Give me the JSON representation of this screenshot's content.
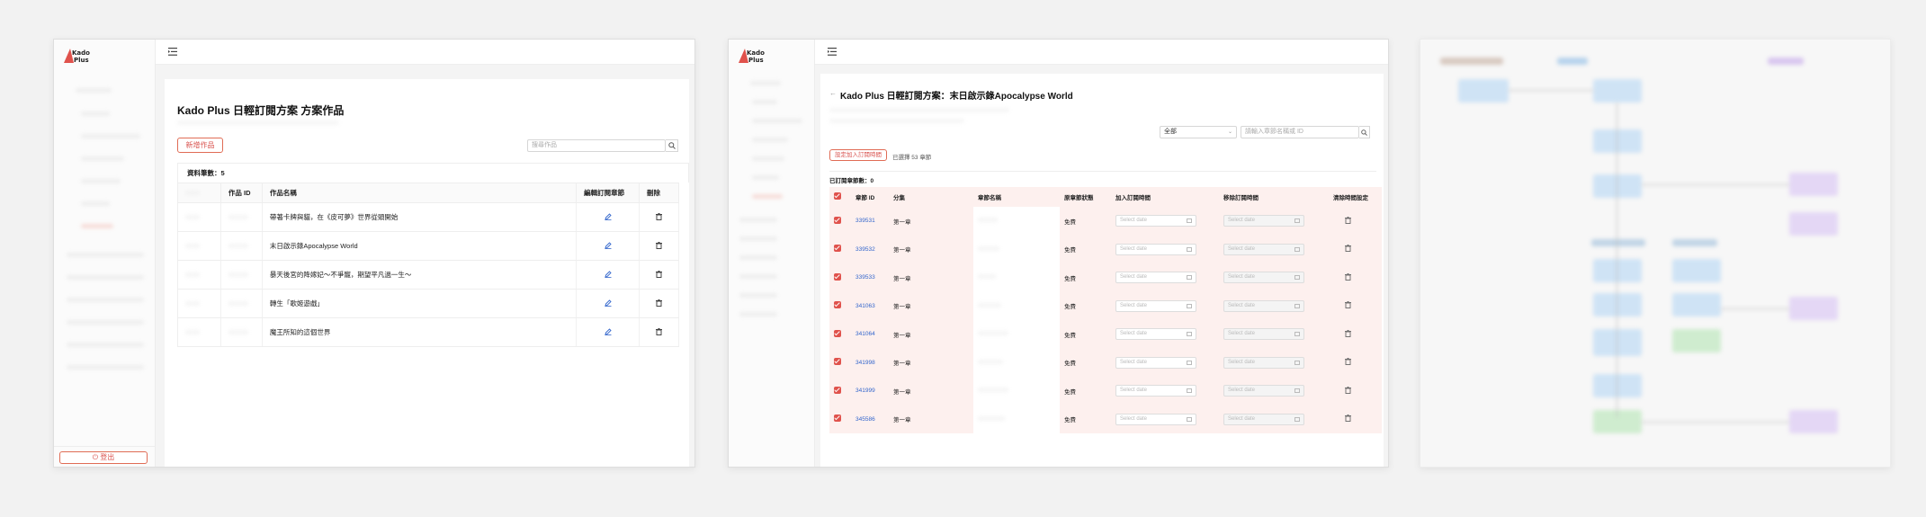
{
  "window1": {
    "logout_label": "登出",
    "page_title": "Kado Plus 日輕訂閱方案 方案作品",
    "add_button": "新增作品",
    "search_placeholder": "搜尋作品",
    "record_count": "資料筆數：5",
    "columns": [
      "",
      "作品 ID",
      "作品名稱",
      "編輯訂閱章節",
      "刪除"
    ],
    "rows": [
      {
        "name": "帶著卡牌與貓，在《皮可夢》世界從頭開始"
      },
      {
        "name": "末日啟示錄Apocalypse World"
      },
      {
        "name": "暴天後宮的降嫁妃～不爭寵，期望平凡過一生～"
      },
      {
        "name": "轉生「歌姬遊戲」"
      },
      {
        "name": "魔王所知的這個世界"
      }
    ]
  },
  "window2": {
    "page_title": "Kado Plus 日輕訂閱方案：末日啟示錄Apocalypse World",
    "filter_select": "全部",
    "chapter_search_placeholder": "請輸入章節名稱或 ID",
    "set_time_button": "設定加入訂閱時間",
    "selected_count": "已選擇 53 章節",
    "subscribed_count": "已訂閱章節數：0",
    "columns": [
      "",
      "章節 ID",
      "分集",
      "章節名稱",
      "原章節狀態",
      "加入訂閱時間",
      "移除訂閱時間",
      "清除時間設定"
    ],
    "date_placeholder": "Select date",
    "rows": [
      {
        "id": "339531",
        "episode": "第一章",
        "status": "免費"
      },
      {
        "id": "339532",
        "episode": "第一章",
        "status": "免費"
      },
      {
        "id": "339533",
        "episode": "第一章",
        "status": "免費"
      },
      {
        "id": "341063",
        "episode": "第一章",
        "status": "免費"
      },
      {
        "id": "341064",
        "episode": "第一章",
        "status": "免費"
      },
      {
        "id": "341998",
        "episode": "第一章",
        "status": "免費"
      },
      {
        "id": "341999",
        "episode": "第一章",
        "status": "免費"
      },
      {
        "id": "345586",
        "episode": "第一章",
        "status": "免費"
      }
    ]
  },
  "icons": {
    "menu": "menu-fold-icon",
    "search": "search-icon",
    "edit": "pencil-icon",
    "delete": "trash-icon",
    "logout": "logout-icon",
    "calendar": "calendar-icon",
    "back": "back-arrow-icon"
  },
  "colors": {
    "accent": "#e0524c",
    "link": "#3366cc",
    "row_highlight": "#fdf0ee"
  }
}
